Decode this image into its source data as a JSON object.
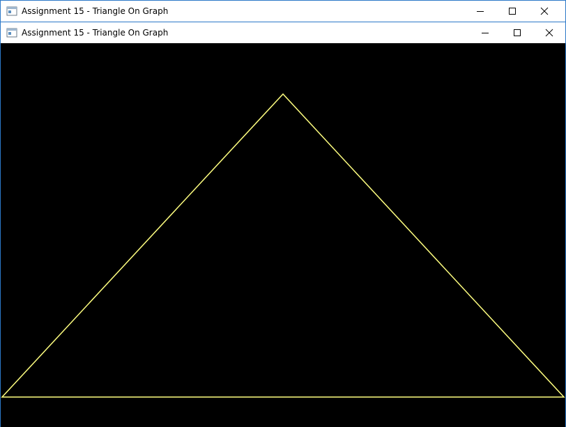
{
  "windows": {
    "back": {
      "title": "Assignment 15 - Triangle On Graph"
    },
    "front": {
      "title": "Assignment 15 - Triangle On Graph"
    }
  },
  "icons": {
    "app": "app-window-icon",
    "minimize": "minimize-icon",
    "maximize": "maximize-icon",
    "close": "close-icon"
  },
  "colors": {
    "canvas_background": "#000000",
    "triangle_stroke": "#ffff80",
    "window_border": "#2b78c8"
  }
}
